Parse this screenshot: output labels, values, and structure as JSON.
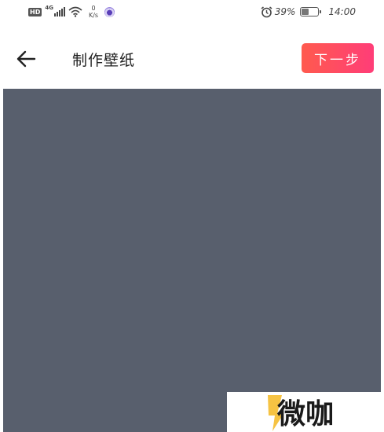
{
  "status_bar": {
    "hd": "HD",
    "network": "4G",
    "speed_value": "0",
    "speed_unit": "K/s",
    "battery": "39%",
    "battery_level": 0.39,
    "time": "14:00"
  },
  "header": {
    "back_icon": "back-arrow-icon",
    "title": "制作壁纸",
    "next_label": "下一步"
  },
  "canvas": {
    "color": "#585f6d"
  },
  "watermark": {
    "text": "微咖"
  },
  "colors": {
    "accent_start": "#ff5a4e",
    "accent_end": "#ff3d78"
  }
}
